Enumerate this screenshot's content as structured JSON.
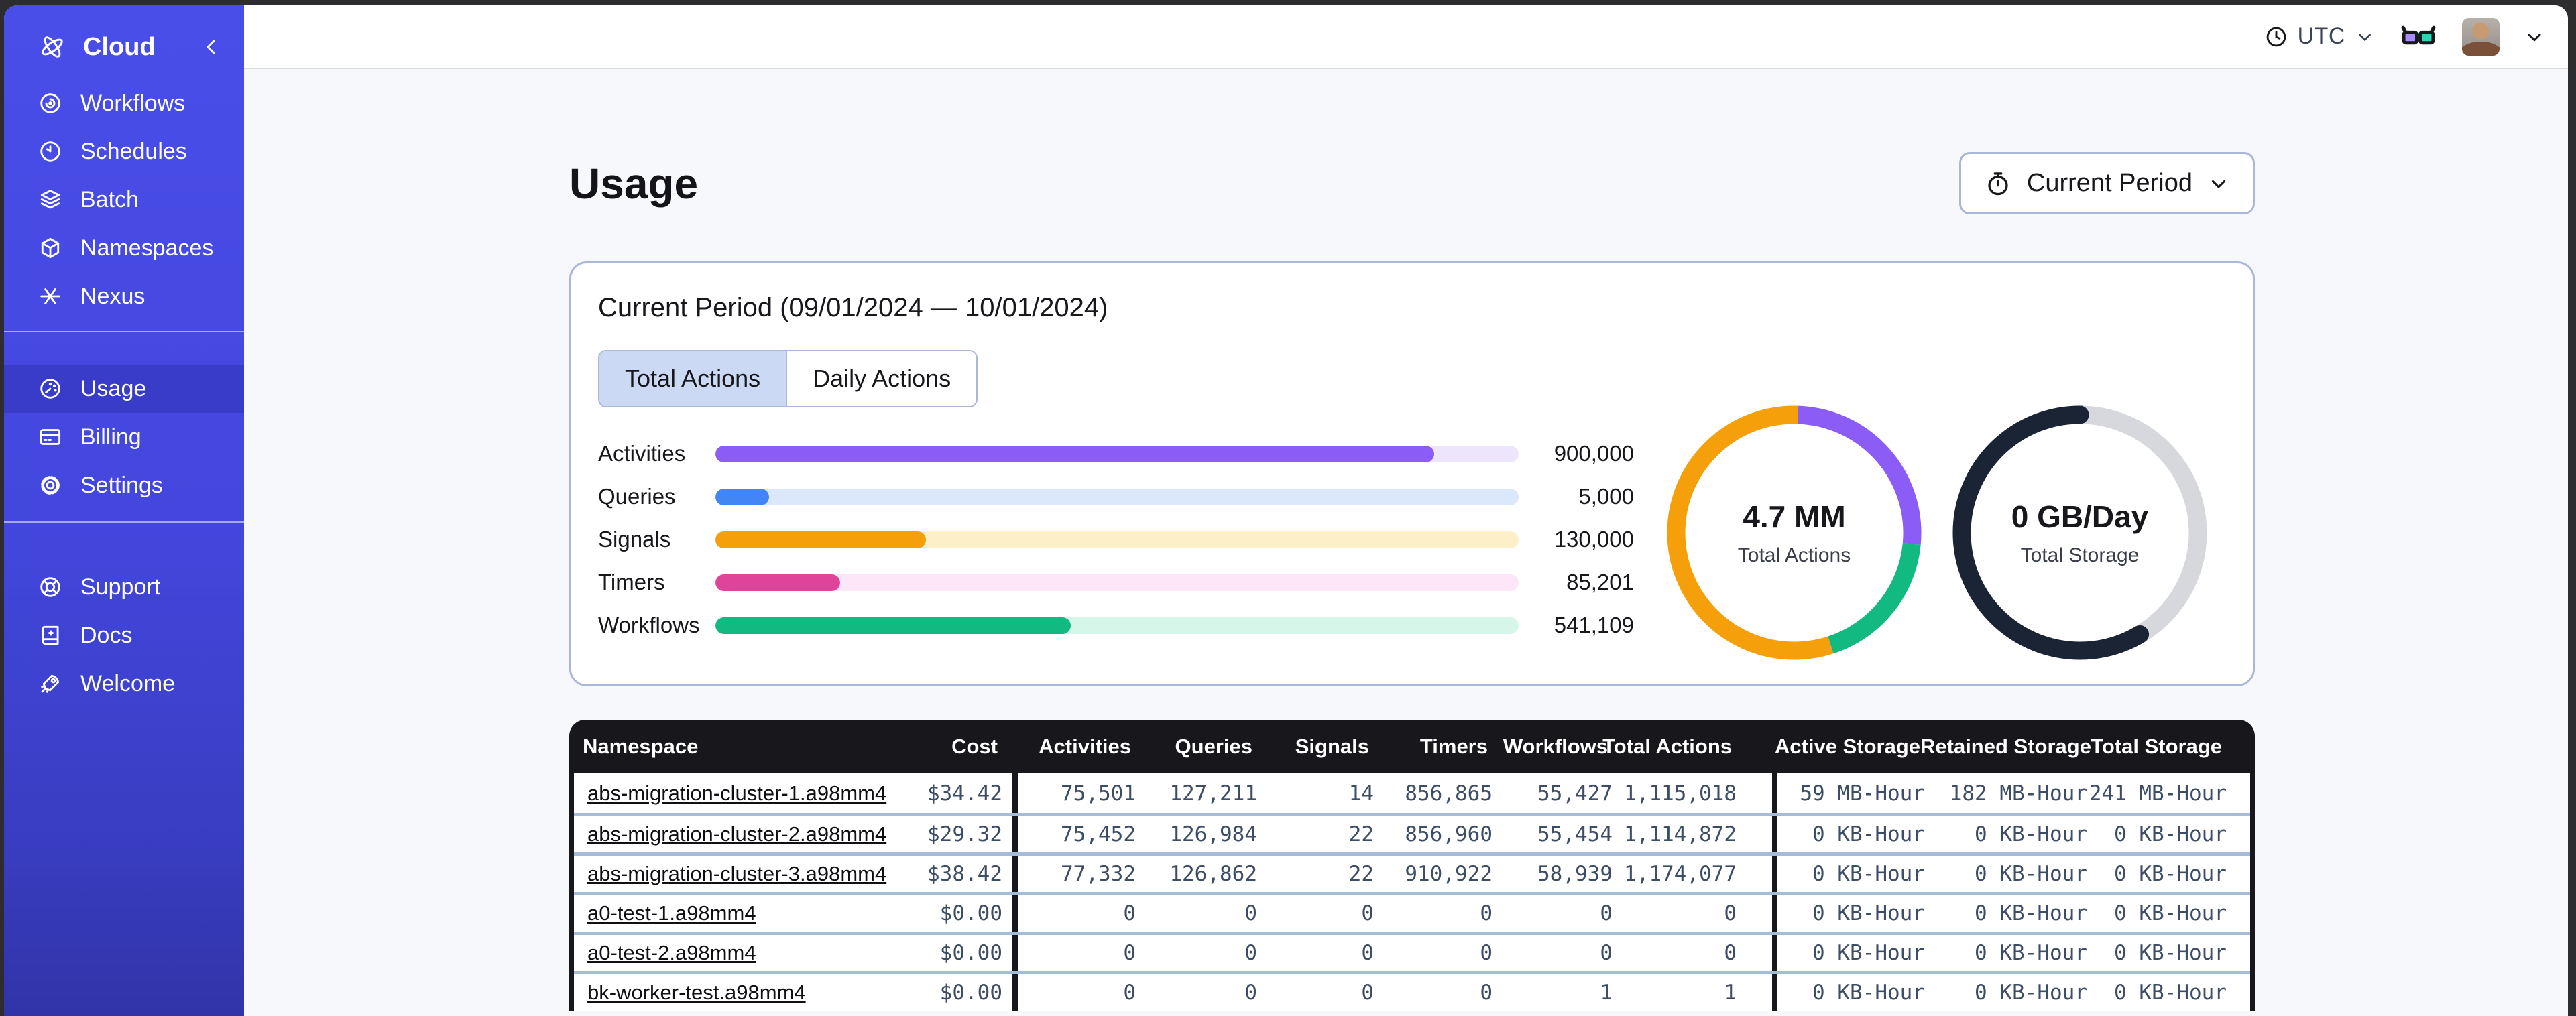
{
  "topbar": {
    "timezone": "UTC",
    "icons": [
      "clock-icon",
      "glasses-icon",
      "avatar",
      "chevron-down-icon"
    ]
  },
  "sidebar": {
    "brand": {
      "label": "Cloud",
      "icon": "cloud-logo-icon",
      "collapse_icon": "chevron-left-icon"
    },
    "primary": [
      {
        "id": "workflows",
        "label": "Workflows",
        "icon": "workflows-icon"
      },
      {
        "id": "schedules",
        "label": "Schedules",
        "icon": "schedules-icon"
      },
      {
        "id": "batch",
        "label": "Batch",
        "icon": "batch-icon"
      },
      {
        "id": "namespaces",
        "label": "Namespaces",
        "icon": "namespaces-icon"
      },
      {
        "id": "nexus",
        "label": "Nexus",
        "icon": "nexus-icon"
      }
    ],
    "account": [
      {
        "id": "usage",
        "label": "Usage",
        "icon": "usage-icon",
        "active": true
      },
      {
        "id": "billing",
        "label": "Billing",
        "icon": "billing-icon"
      },
      {
        "id": "settings",
        "label": "Settings",
        "icon": "settings-icon"
      }
    ],
    "help": [
      {
        "id": "support",
        "label": "Support",
        "icon": "support-icon"
      },
      {
        "id": "docs",
        "label": "Docs",
        "icon": "docs-icon"
      },
      {
        "id": "welcome",
        "label": "Welcome",
        "icon": "welcome-icon"
      }
    ]
  },
  "page": {
    "title": "Usage"
  },
  "period_button": {
    "label": "Current Period",
    "icon": "stopwatch-icon"
  },
  "panel": {
    "title": "Current Period (09/01/2024 — 10/01/2024)",
    "tabs": [
      {
        "label": "Total Actions",
        "active": true
      },
      {
        "label": "Daily Actions",
        "active": false
      }
    ]
  },
  "chart_data": [
    {
      "type": "bar",
      "orientation": "horizontal",
      "categories": [
        "Activities",
        "Queries",
        "Signals",
        "Timers",
        "Workflows"
      ],
      "values": [
        900000,
        5000,
        130000,
        85201,
        541109
      ],
      "value_labels": [
        "900,000",
        "5,000",
        "130,000",
        "85,201",
        "541,109"
      ],
      "fill_pct": [
        89.5,
        6.7,
        26.2,
        15.5,
        44.2
      ],
      "fill_colors": [
        "#8b5cf6",
        "#4285f4",
        "#f5a00b",
        "#e0449a",
        "#12b981"
      ],
      "track_colors": [
        "#ece5fc",
        "#dbe8fb",
        "#fdf0c9",
        "#fce6f7",
        "#d5f6e8"
      ]
    },
    {
      "type": "pie",
      "title": "Total Actions donut",
      "center_value": "4.7 MM",
      "center_label": "Total Actions",
      "segments": [
        {
          "name": "activities",
          "color": "#8b5cf6",
          "start_pct": 0.5,
          "len_pct": 26.0
        },
        {
          "name": "workflows",
          "color": "#12b981",
          "start_pct": 26.5,
          "len_pct": 18.5
        },
        {
          "name": "signals",
          "color": "#f5a00b",
          "start_pct": 45.0,
          "len_pct": 55.5
        }
      ]
    },
    {
      "type": "pie",
      "title": "Total Storage donut",
      "center_value": "0 GB/Day",
      "center_label": "Total Storage",
      "track_color": "#d6d8dd",
      "segments": [
        {
          "name": "storage",
          "color": "#1b2434",
          "start_pct": 41.5,
          "len_pct": 58.5,
          "round": true
        }
      ]
    }
  ],
  "table": {
    "columns": [
      "Namespace",
      "Cost",
      "Activities",
      "Queries",
      "Signals",
      "Timers",
      "Workflows",
      "Total Actions",
      "Active Storage",
      "Retained Storage",
      "Total Storage"
    ],
    "rows": [
      {
        "namespace": "abs-migration-cluster-1.a98mm4",
        "cost": "$34.42",
        "activities": "75,501",
        "queries": "127,211",
        "signals": "14",
        "timers": "856,865",
        "workflows": "55,427",
        "total_actions": "1,115,018",
        "active_storage": "59 MB-Hour",
        "retained_storage": "182 MB-Hour",
        "total_storage": "241 MB-Hour"
      },
      {
        "namespace": "abs-migration-cluster-2.a98mm4",
        "cost": "$29.32",
        "activities": "75,452",
        "queries": "126,984",
        "signals": "22",
        "timers": "856,960",
        "workflows": "55,454",
        "total_actions": "1,114,872",
        "active_storage": "0 KB-Hour",
        "retained_storage": "0 KB-Hour",
        "total_storage": "0 KB-Hour"
      },
      {
        "namespace": "abs-migration-cluster-3.a98mm4",
        "cost": "$38.42",
        "activities": "77,332",
        "queries": "126,862",
        "signals": "22",
        "timers": "910,922",
        "workflows": "58,939",
        "total_actions": "1,174,077",
        "active_storage": "0 KB-Hour",
        "retained_storage": "0 KB-Hour",
        "total_storage": "0 KB-Hour"
      },
      {
        "namespace": "a0-test-1.a98mm4",
        "cost": "$0.00",
        "activities": "0",
        "queries": "0",
        "signals": "0",
        "timers": "0",
        "workflows": "0",
        "total_actions": "0",
        "active_storage": "0 KB-Hour",
        "retained_storage": "0 KB-Hour",
        "total_storage": "0 KB-Hour"
      },
      {
        "namespace": "a0-test-2.a98mm4",
        "cost": "$0.00",
        "activities": "0",
        "queries": "0",
        "signals": "0",
        "timers": "0",
        "workflows": "0",
        "total_actions": "0",
        "active_storage": "0 KB-Hour",
        "retained_storage": "0 KB-Hour",
        "total_storage": "0 KB-Hour"
      },
      {
        "namespace": "bk-worker-test.a98mm4",
        "cost": "$0.00",
        "activities": "0",
        "queries": "0",
        "signals": "0",
        "timers": "0",
        "workflows": "1",
        "total_actions": "1",
        "active_storage": "0 KB-Hour",
        "retained_storage": "0 KB-Hour",
        "total_storage": "0 KB-Hour"
      }
    ]
  },
  "colors": {
    "sidebar": "#4347de",
    "sidebar_active": "#383cc9",
    "accent_border": "#a9b7d8",
    "tab_active_bg": "#ccd9f4",
    "table_header_bg": "#17171c",
    "row_divider": "#a6bad9",
    "mono_text": "#3d4d66",
    "content_bg": "#f7f8fb"
  }
}
